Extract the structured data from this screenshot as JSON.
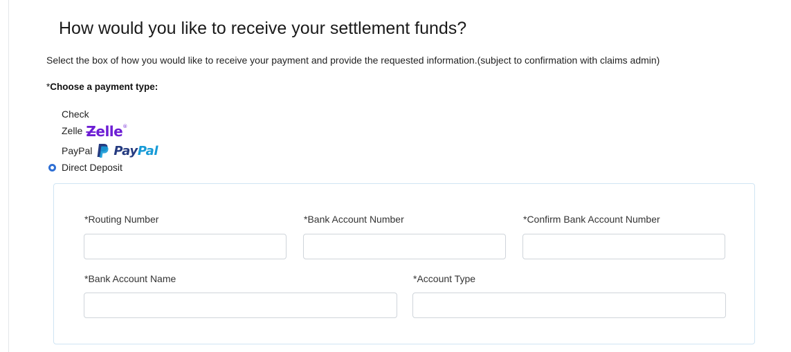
{
  "page": {
    "title": "How would you like to receive your settlement funds?",
    "instructions": "Select the box of how you would like to receive your payment and provide the requested information.(subject to confirmation with claims admin)"
  },
  "payment_type": {
    "required_mark": "*",
    "label": "Choose a payment type:",
    "options": [
      {
        "label": "Check",
        "selected": false
      },
      {
        "label": "Zelle",
        "selected": false,
        "logo": "zelle-logo"
      },
      {
        "label": "PayPal",
        "selected": false,
        "logo": "paypal-logo"
      },
      {
        "label": "Direct Deposit",
        "selected": true
      }
    ],
    "selected_value": "Direct Deposit"
  },
  "logos": {
    "zelle_text": "Zelle",
    "paypal_pay": "Pay",
    "paypal_pal": "Pal"
  },
  "direct_deposit": {
    "routing_number": {
      "label": "*Routing Number",
      "value": ""
    },
    "bank_account_number": {
      "label": "*Bank Account Number",
      "value": ""
    },
    "confirm_bank_account_number": {
      "label": "*Confirm Bank Account Number",
      "value": ""
    },
    "bank_account_name": {
      "label": "*Bank Account Name",
      "value": ""
    },
    "account_type": {
      "label": "*Account Type",
      "value": ""
    }
  },
  "colors": {
    "radio_selected": "#2e6fd4",
    "zelle_purple": "#6d1ed4",
    "paypal_dark": "#253b80",
    "paypal_light": "#179bd7",
    "panel_border": "#cfe4f3"
  }
}
